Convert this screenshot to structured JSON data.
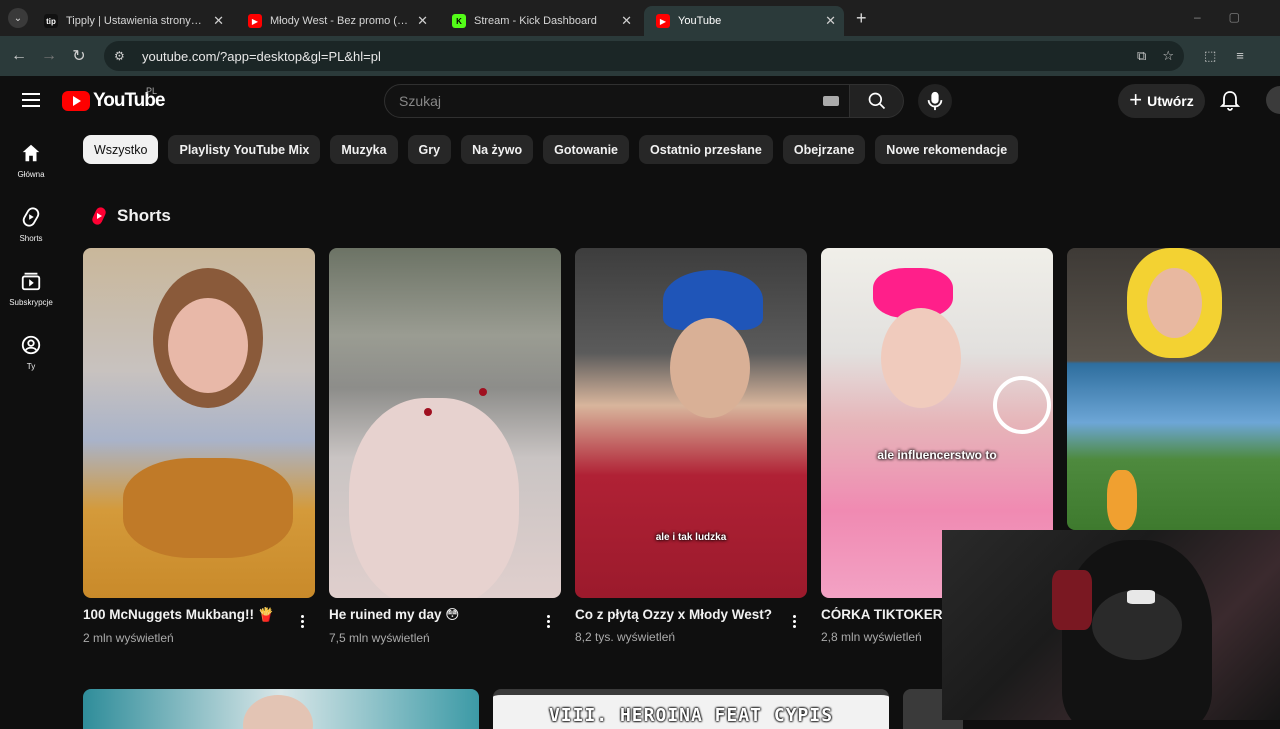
{
  "browser": {
    "tabs": [
      {
        "title": "Tipply | Ustawienia strony zamówień",
        "favicon": "tip",
        "active": false
      },
      {
        "title": "Młody West - Bez promo (Official Vid",
        "favicon": "youtube-icon",
        "active": false
      },
      {
        "title": "Stream - Kick Dashboard",
        "favicon": "K",
        "active": false
      },
      {
        "title": "YouTube",
        "favicon": "youtube-icon",
        "active": true
      }
    ],
    "url": "youtube.com/?app=desktop&gl=PL&hl=pl"
  },
  "masthead": {
    "logo_text": "YouTube",
    "country_code": "PL",
    "search_placeholder": "Szukaj",
    "create_label": "Utwórz"
  },
  "guide": {
    "items": [
      {
        "label": "Główna",
        "icon": "home-icon"
      },
      {
        "label": "Shorts",
        "icon": "shorts-icon"
      },
      {
        "label": "Subskrypcje",
        "icon": "subscriptions-icon"
      },
      {
        "label": "Ty",
        "icon": "you-icon"
      }
    ]
  },
  "chips": [
    "Wszystko",
    "Playlisty YouTube Mix",
    "Muzyka",
    "Gry",
    "Na żywo",
    "Gotowanie",
    "Ostatnio przesłane",
    "Obejrzane",
    "Nowe rekomendacje"
  ],
  "shorts": {
    "heading": "Shorts",
    "items": [
      {
        "title": "100 McNuggets Mukbang!! 🍟",
        "views": "2 mln wyświetleń",
        "overlay": ""
      },
      {
        "title": "He ruined my day 😳",
        "views": "7,5 mln wyświetleń",
        "overlay": ""
      },
      {
        "title": "Co z płytą Ozzy x Młody West?",
        "views": "8,2 tys. wyświetleń",
        "overlay": "ale i tak ludzka"
      },
      {
        "title": "CÓRKA TIKTOKERK",
        "views": "2,8 mln wyświetleń",
        "overlay": "ale influencerstwo to"
      }
    ]
  },
  "next_row": {
    "banner_text": "VIII. HEROINA FEAT CYPIS"
  },
  "colors": {
    "background": "#0f0f0f",
    "chip": "#272727",
    "brand_red": "#ff0000",
    "browser_toolbar": "#2b3a3a"
  }
}
